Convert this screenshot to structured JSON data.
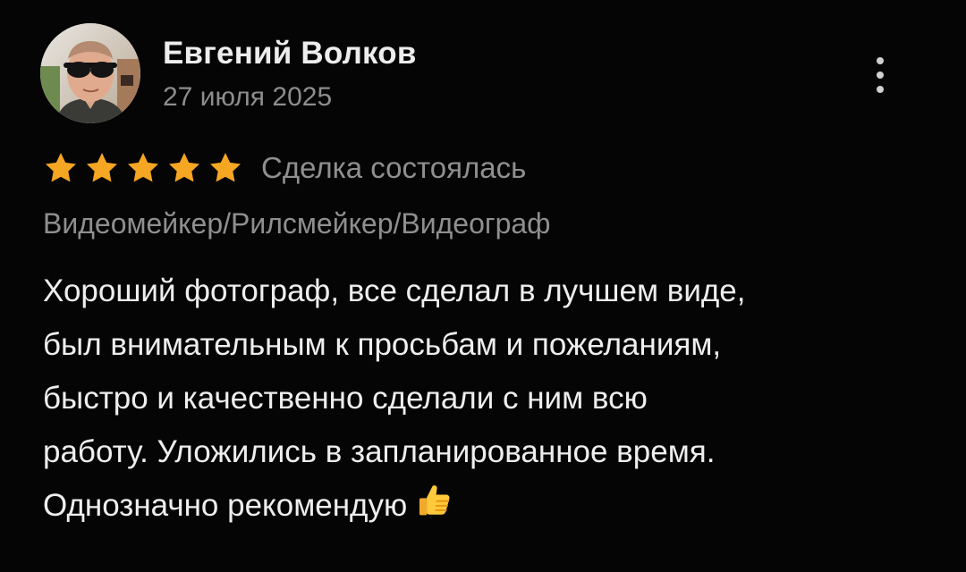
{
  "review": {
    "author_name": "Евгений Волков",
    "date": "27 июля 2025",
    "rating": 5,
    "rating_max": 5,
    "deal_status": "Сделка состоялась",
    "category": "Видеомейкер/Рилсмейкер/Видеограф",
    "text_lines": [
      "Хороший фотограф, все сделал в лучшем виде,",
      "был внимательным к просьбам и пожеланиям,",
      "быстро и качественно сделали с ним всю",
      "работу. Уложились в запланированное время.",
      "Однозначно рекомендую"
    ],
    "emoji": "thumbs-up-icon"
  },
  "colors": {
    "background": "#050505",
    "star": "#f5a623",
    "secondary_text": "#8f8f8f"
  }
}
